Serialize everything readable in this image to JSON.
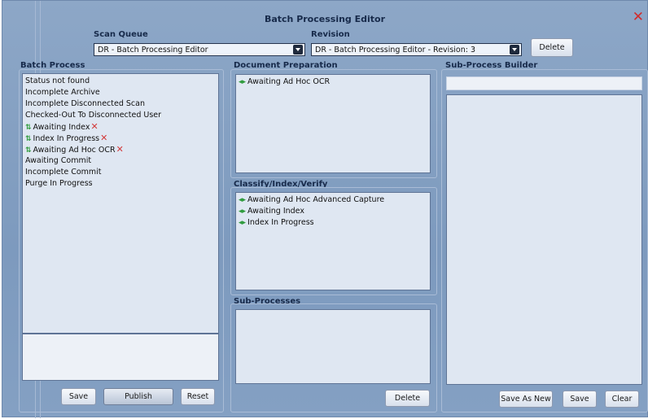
{
  "window": {
    "title": "Batch Processing Editor"
  },
  "header": {
    "scan_queue_label": "Scan Queue",
    "scan_queue_value": "DR - Batch Processing Editor",
    "revision_label": "Revision",
    "revision_value": "DR - Batch Processing Editor - Revision: 3",
    "delete_label": "Delete"
  },
  "batch_process": {
    "heading": "Batch Process",
    "items": [
      {
        "label": "Status not found"
      },
      {
        "label": "Incomplete Archive"
      },
      {
        "label": "Incomplete Disconnected Scan"
      },
      {
        "label": "Checked-Out To Disconnected User"
      },
      {
        "label": "Awaiting Index",
        "icon": "up-down-arrows-icon",
        "removable": true
      },
      {
        "label": "Index In Progress",
        "icon": "up-down-arrows-icon",
        "removable": true
      },
      {
        "label": "Awaiting Ad Hoc OCR",
        "icon": "up-down-arrows-icon",
        "removable": true
      },
      {
        "label": "Awaiting Commit"
      },
      {
        "label": "Incomplete Commit"
      },
      {
        "label": "Purge In Progress"
      }
    ],
    "save_label": "Save",
    "publish_label": "Publish",
    "reset_label": "Reset"
  },
  "document_preparation": {
    "heading": "Document Preparation",
    "items": [
      {
        "label": "Awaiting Ad Hoc OCR",
        "icon": "left-right-arrows-icon"
      }
    ]
  },
  "classify_index_verify": {
    "heading": "Classify/Index/Verify",
    "items": [
      {
        "label": "Awaiting Ad Hoc Advanced Capture",
        "icon": "left-right-arrows-icon"
      },
      {
        "label": "Awaiting Index",
        "icon": "left-right-arrows-icon"
      },
      {
        "label": "Index In Progress",
        "icon": "left-right-arrows-icon"
      }
    ]
  },
  "sub_processes": {
    "heading": "Sub-Processes",
    "delete_label": "Delete"
  },
  "sub_process_builder": {
    "heading": "Sub-Process Builder",
    "name_value": "",
    "save_as_new_label": "Save As New",
    "save_label": "Save",
    "clear_label": "Clear"
  },
  "colors": {
    "accent_close": "#d12c2c",
    "indicator_green": "#2f9b3d",
    "remove_red": "#d23a3a"
  }
}
